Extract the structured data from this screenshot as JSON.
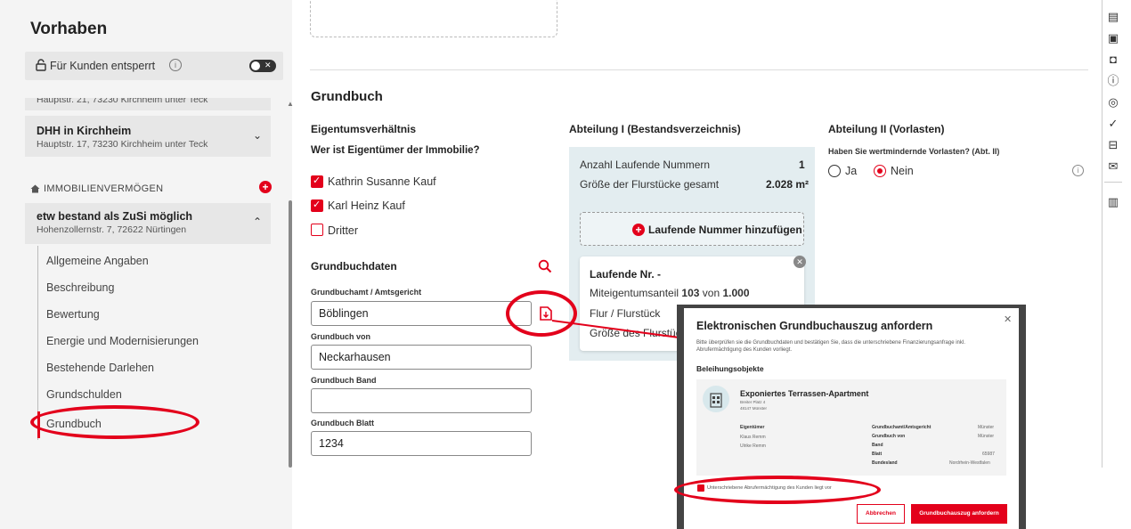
{
  "sidebar": {
    "title": "Vorhaben",
    "lock_text": "Für Kunden entsperrt",
    "clipped_address": "Hauptstr. 21, 73230 Kirchheim unter Teck",
    "card1": {
      "title": "DHH in Kirchheim",
      "address": "Hauptstr. 17, 73230 Kirchheim unter Teck"
    },
    "section_label": "IMMOBILIENVERMÖGEN",
    "card2": {
      "title": "etw bestand als ZuSi möglich",
      "address": "Hohenzollernstr. 7, 72622 Nürtingen"
    },
    "nav": [
      "Allgemeine Angaben",
      "Beschreibung",
      "Bewertung",
      "Energie und Modernisierungen",
      "Bestehende Darlehen",
      "Grundschulden",
      "Grundbuch"
    ]
  },
  "main": {
    "heading": "Grundbuch",
    "eigentum": {
      "header": "Eigentumsverhältnis",
      "question": "Wer ist Eigentümer der Immobilie?",
      "owners": [
        {
          "label": "Kathrin Susanne Kauf",
          "checked": true
        },
        {
          "label": "Karl Heinz Kauf",
          "checked": true
        },
        {
          "label": "Dritter",
          "checked": false
        }
      ]
    },
    "grundbuchdaten": {
      "header": "Grundbuchdaten",
      "amt_label": "Grundbuchamt / Amtsgericht",
      "amt_value": "Böblingen",
      "von_label": "Grundbuch von",
      "von_value": "Neckarhausen",
      "band_label": "Grundbuch Band",
      "band_value": "",
      "blatt_label": "Grundbuch Blatt",
      "blatt_value": "1234"
    },
    "abt1": {
      "header": "Abteilung I (Bestandsverzeichnis)",
      "anzahl_label": "Anzahl Laufende Nummern",
      "anzahl_value": "1",
      "groesse_label": "Größe der Flurstücke gesamt",
      "groesse_value": "2.028 m²",
      "add_label": "Laufende Nummer hinzufügen",
      "lf_title": "Laufende Nr. -",
      "lf_anteil_prefix": "Miteigentumsanteil",
      "lf_anteil_a": "103",
      "lf_anteil_von": "von",
      "lf_anteil_b": "1.000",
      "lf_flur": "Flur / Flurstück",
      "lf_groesse": "Größe des Flurstücks"
    },
    "abt2": {
      "header": "Abteilung II (Vorlasten)",
      "question": "Haben Sie wertmindernde Vorlasten? (Abt. II)",
      "yes": "Ja",
      "no": "Nein",
      "selected": "Nein"
    }
  },
  "modal": {
    "title": "Elektronischen Grundbuchauszug anfordern",
    "desc": "Bitte überprüfen sie die Grundbuchdaten und bestätigen Sie, dass die unterschriebene Finanzierungsanfrage inkl. Abrufermächtigung des Kunden vorliegt.",
    "section": "Beleihungsobjekte",
    "object_title": "Exponiertes Terrassen-Apartment",
    "object_street": "Breiter Platz 4",
    "object_city": "48147 Münster",
    "owners_label": "Eigentümer",
    "owner1": "Klaus Remm",
    "owner2": "Ulrike Remm",
    "kv": [
      {
        "k": "Grundbuchamt/Amtsgericht",
        "v": "Münster"
      },
      {
        "k": "Grundbuch von",
        "v": "Münster"
      },
      {
        "k": "Band",
        "v": ""
      },
      {
        "k": "Blatt",
        "v": "65987"
      },
      {
        "k": "Bundesland",
        "v": "Nordrhein-Westfalen"
      }
    ],
    "checkbox_label": "Unterschriebene Abrufermächtigung des Kunden liegt vor",
    "cancel": "Abbrechen",
    "submit": "Grundbuchauszug anfordern"
  },
  "colors": {
    "accent": "#e3001b",
    "panel": "#e3edf0",
    "sidebar": "#f4f4f4"
  }
}
